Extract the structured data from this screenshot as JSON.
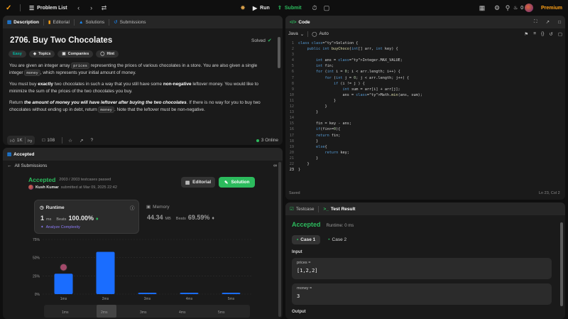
{
  "topbar": {
    "problem_list": "Problem List",
    "run": "Run",
    "submit": "Submit",
    "streak": "0",
    "premium": "Premium"
  },
  "left_panel": {
    "tabs": [
      "Description",
      "Editorial",
      "Solutions",
      "Submissions"
    ],
    "title": "2706. Buy Two Chocolates",
    "solved": "Solved",
    "tags": [
      "Easy",
      "Topics",
      "Companies",
      "Hint"
    ],
    "paragraphs": {
      "p1a": "You are given an integer array ",
      "p1b": "prices",
      "p1c": " representing the prices of various chocolates in a store. You are also given a single integer ",
      "p1d": "money",
      "p1e": ", which represents your initial amount of money.",
      "p2a": "You must buy ",
      "p2b": "exactly",
      "p2c": " two chocolates in such a way that you still have some ",
      "p2d": "non-negative",
      "p2e": " leftover money. You would like to minimize the sum of the prices of the two chocolates you buy.",
      "p3a": "Return ",
      "p3b": "the amount of money you will have leftover after buying the two chocolates",
      "p3c": ". If there is no way for you to buy two chocolates without ending up in debt, return ",
      "p3d": "money",
      "p3e": ". Note that the leftover must be non-negative."
    },
    "footer": {
      "likes": "1K",
      "comments": "108",
      "online": "3 Online"
    }
  },
  "accepted_panel": {
    "tab": "Accepted",
    "back": "All Submissions",
    "status": "Accepted",
    "testcases": "2003 / 2003 testcases passed",
    "user": "Kush Kumar",
    "submitted": "submitted at Mar 09, 2025 22:42",
    "editorial_btn": "Editorial",
    "solution_btn": "Solution",
    "runtime_label": "Runtime",
    "runtime_value": "1",
    "runtime_unit": "ms",
    "beats_label": "Beats",
    "runtime_beats": "100.00%",
    "analyze": "Analyze Complexity",
    "memory_label": "Memory",
    "memory_value": "44.34",
    "memory_unit": "MB",
    "memory_beats": "69.59%"
  },
  "chart_data": {
    "type": "bar",
    "categories": [
      "1ms",
      "2ms",
      "3ms",
      "4ms",
      "5ms"
    ],
    "values": [
      28,
      58,
      2,
      2,
      2
    ],
    "ylim": [
      0,
      75
    ],
    "yticks": [
      "75%",
      "50%",
      "25%",
      "0%"
    ],
    "avatar_on": "1ms",
    "bar_color": "#1a6dff"
  },
  "code_panel": {
    "title": "Code",
    "language": "Java",
    "mode": "Auto",
    "saved": "Saved",
    "cursor": "Ln 23, Col 2",
    "lines": [
      "class Solution {",
      "    public int buyChoco(int[] arr, int key) {",
      "",
      "        int ans = Integer.MAX_VALUE;",
      "        int fin;",
      "        for (int i = 0; i < arr.length; i++) {",
      "            for (int j = 0; j < arr.length; j++) {",
      "                if (i != j ) {",
      "                    int sum = arr[i] + arr[j];",
      "                    ans = Math.min(ans, sum);",
      "                }",
      "            }",
      "        }",
      "",
      "        fin = key - ans;",
      "        if(fin>=0){",
      "        return fin;",
      "        }",
      "        else{",
      "            return key;",
      "        }",
      "    }",
      "}"
    ],
    "line_numbers": [
      "1",
      "2",
      "3",
      "4",
      "5",
      "6",
      "7",
      "8",
      "9",
      "10",
      "11",
      "12",
      "13",
      "14",
      "15",
      "16",
      "17",
      "18",
      "19",
      "20",
      "21",
      "22",
      "23"
    ]
  },
  "test_panel": {
    "tab_testcase": "Testcase",
    "tab_result": "Test Result",
    "status": "Accepted",
    "runtime": "Runtime: 0 ms",
    "case1": "Case 1",
    "case2": "Case 2",
    "input_label": "Input",
    "prices_label": "prices =",
    "prices_value": "[1,2,2]",
    "money_label": "money =",
    "money_value": "3",
    "output_label": "Output"
  },
  "colors": {
    "accent_green": "#2cbb5d",
    "orange": "#ffa116",
    "blue": "#1a6dff",
    "teal_easy": "#00b8a3"
  }
}
